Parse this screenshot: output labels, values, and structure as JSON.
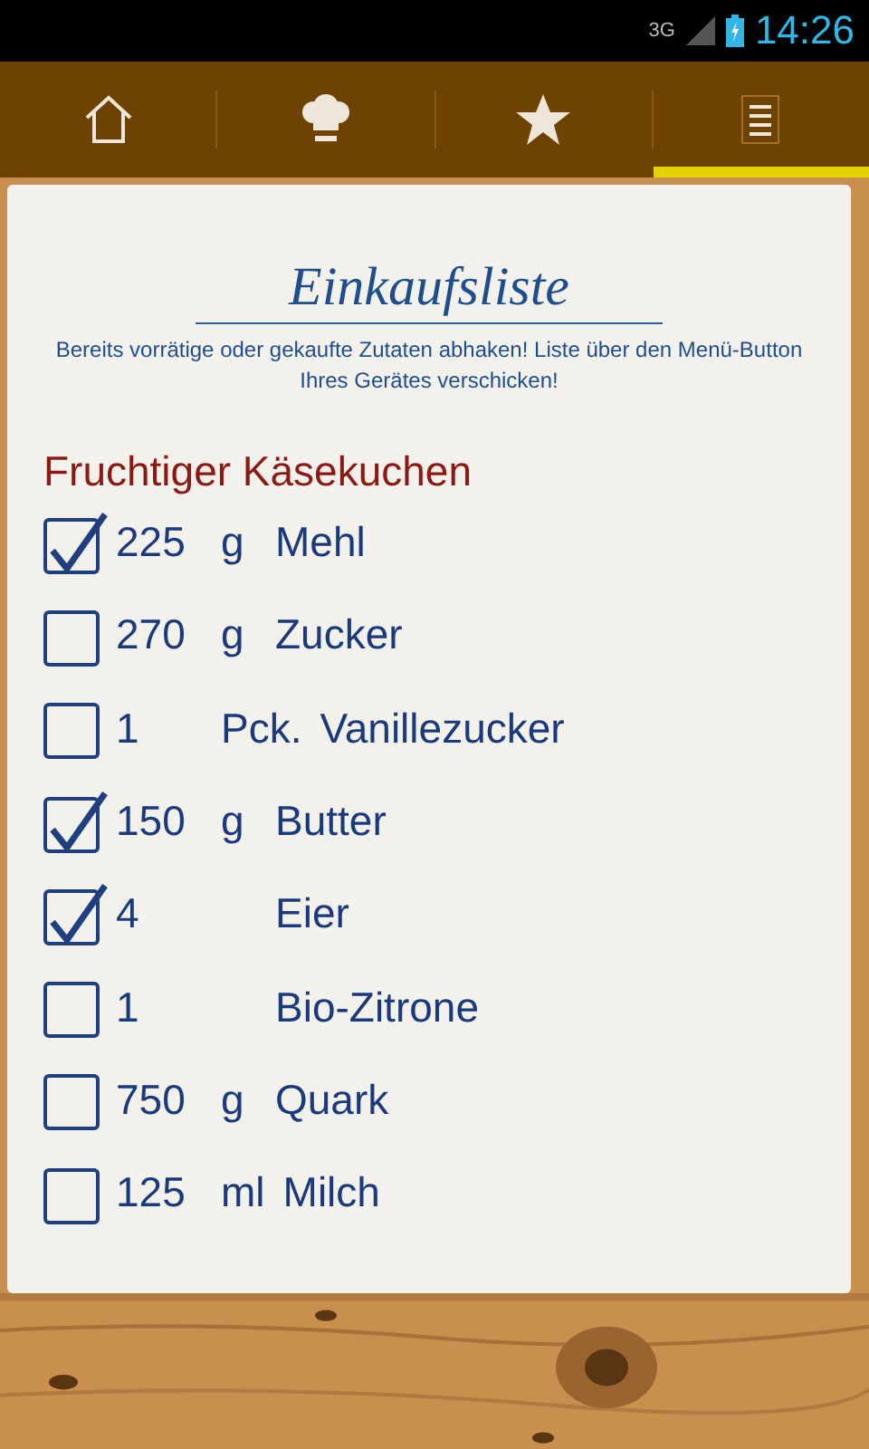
{
  "status_bar": {
    "network": "3G",
    "time": "14:26"
  },
  "tabs": [
    {
      "kind": "home",
      "selected": false
    },
    {
      "kind": "chef",
      "selected": false
    },
    {
      "kind": "star",
      "selected": false
    },
    {
      "kind": "list",
      "selected": true
    }
  ],
  "title": "Einkaufsliste",
  "hint": "Bereits vorrätige oder gekaufte Zutaten abhaken! Liste über den Menü-Button Ihres Gerätes verschicken!",
  "recipe": "Fruchtiger Käsekuchen",
  "items": [
    {
      "amount": "225",
      "unit": "g",
      "name": "Mehl",
      "checked": true
    },
    {
      "amount": "270",
      "unit": "g",
      "name": "Zucker",
      "checked": false
    },
    {
      "amount": "1",
      "unit": "Pck.",
      "name": "Vanillezucker",
      "checked": false
    },
    {
      "amount": "150",
      "unit": "g",
      "name": "Butter",
      "checked": true
    },
    {
      "amount": "4",
      "name": "Eier",
      "checked": true
    },
    {
      "amount": "1",
      "name": "Bio-Zitrone",
      "checked": false
    },
    {
      "amount": "750",
      "unit": "g",
      "name": "Quark",
      "checked": false
    },
    {
      "amount": "125",
      "unit": "ml",
      "name": "Milch",
      "checked": false
    }
  ]
}
